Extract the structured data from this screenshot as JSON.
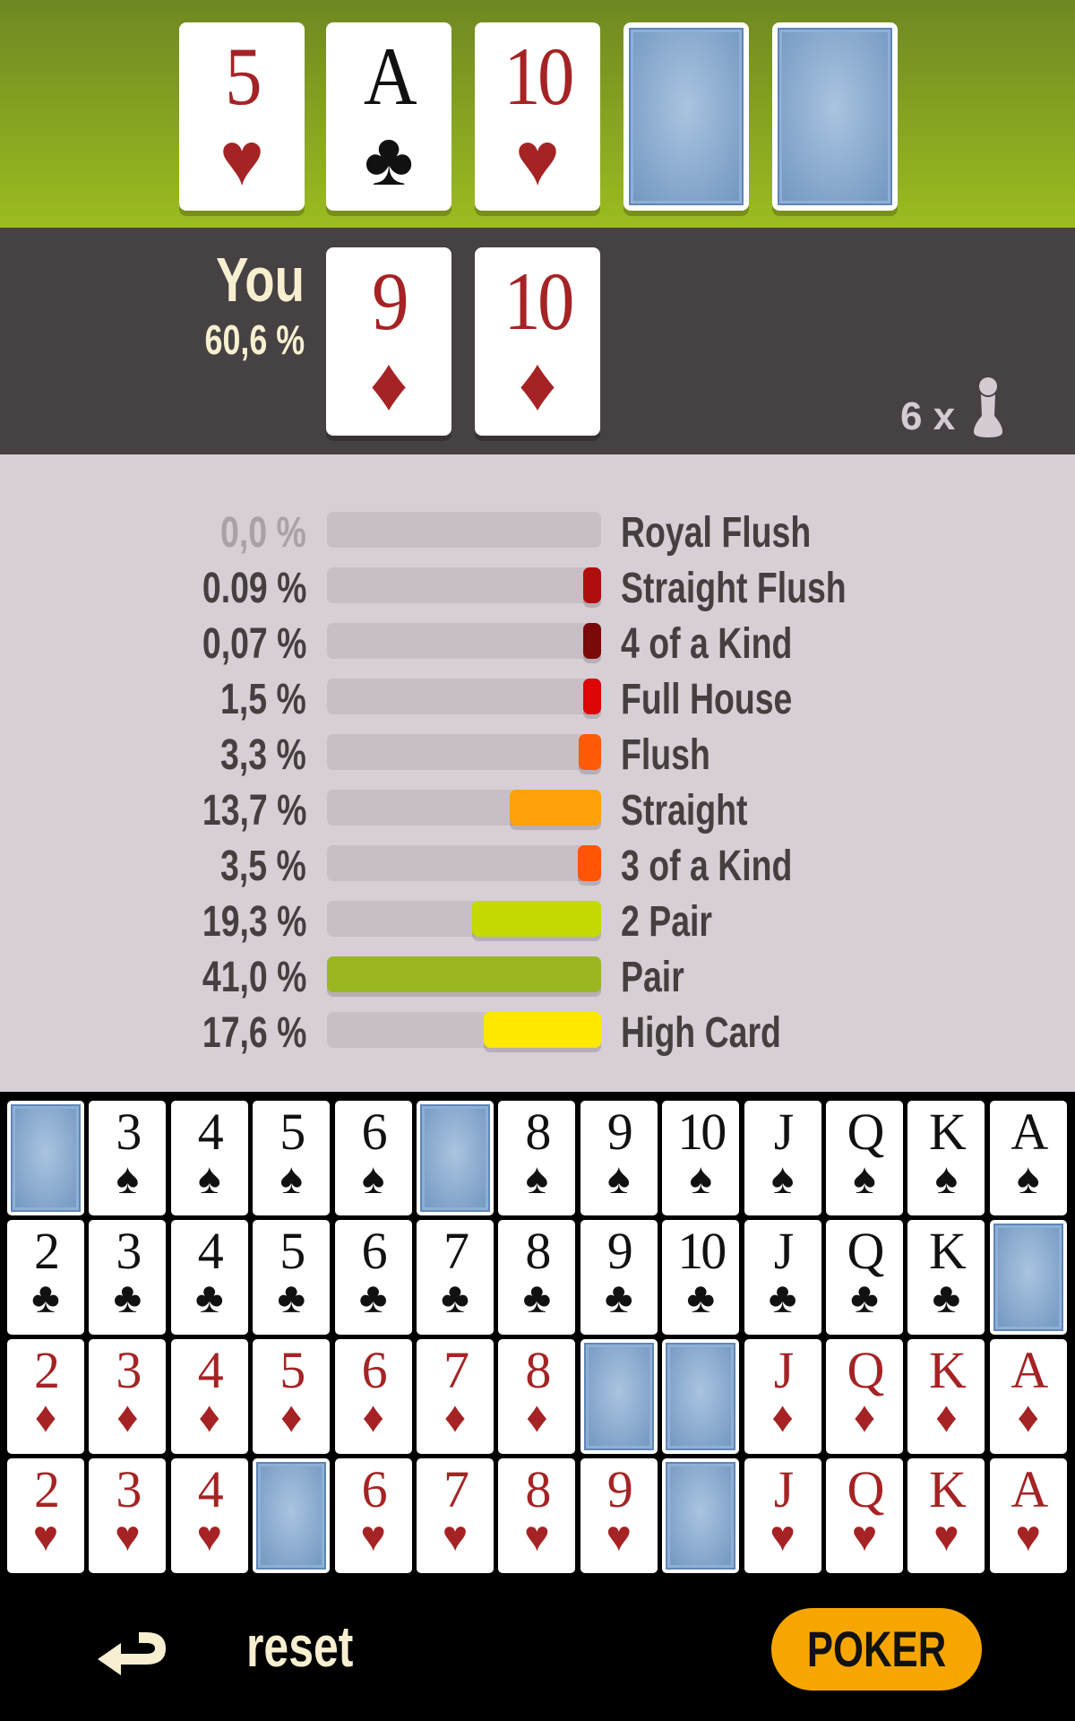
{
  "board": {
    "cards": [
      {
        "rank": "5",
        "suit": "♥",
        "color": "red",
        "face_up": true
      },
      {
        "rank": "A",
        "suit": "♣",
        "color": "black",
        "face_up": true
      },
      {
        "rank": "10",
        "suit": "♥",
        "color": "red",
        "face_up": true
      },
      {
        "face_up": false
      },
      {
        "face_up": false
      }
    ]
  },
  "player": {
    "name": "You",
    "win_percent": "60,6 %",
    "cards": [
      {
        "rank": "9",
        "suit": "♦",
        "color": "red",
        "face_up": true
      },
      {
        "rank": "10",
        "suit": "♦",
        "color": "red",
        "face_up": true
      }
    ],
    "opponents_label": "6 x",
    "opponents_icon": "pawn-icon"
  },
  "hands": [
    {
      "label": "Royal Flush",
      "percent_text": "0,0 %",
      "value": 0.0,
      "color": "#c8bec5"
    },
    {
      "label": "Straight Flush",
      "percent_text": "0.09 %",
      "value": 0.09,
      "color": "#b00d0d"
    },
    {
      "label": "4 of a Kind",
      "percent_text": "0,07 %",
      "value": 0.07,
      "color": "#7a0a0a"
    },
    {
      "label": "Full House",
      "percent_text": "1,5 %",
      "value": 1.5,
      "color": "#dd0505"
    },
    {
      "label": "Flush",
      "percent_text": "3,3 %",
      "value": 3.3,
      "color": "#ff5a07"
    },
    {
      "label": "Straight",
      "percent_text": "13,7 %",
      "value": 13.7,
      "color": "#ffa10a"
    },
    {
      "label": "3 of a Kind",
      "percent_text": "3,5 %",
      "value": 3.5,
      "color": "#ff5505"
    },
    {
      "label": "2 Pair",
      "percent_text": "19,3 %",
      "value": 19.3,
      "color": "#c3d900"
    },
    {
      "label": "Pair",
      "percent_text": "41,0 %",
      "value": 41.0,
      "color": "#9ab722"
    },
    {
      "label": "High Card",
      "percent_text": "17,6 %",
      "value": 17.6,
      "color": "#ffe800"
    }
  ],
  "deck": [
    {
      "suit": "♠",
      "color": "black",
      "ranks": [
        "2",
        "3",
        "4",
        "5",
        "6",
        "7",
        "8",
        "9",
        "10",
        "J",
        "Q",
        "K",
        "A"
      ],
      "hidden": [
        0,
        5
      ]
    },
    {
      "suit": "♣",
      "color": "black",
      "ranks": [
        "2",
        "3",
        "4",
        "5",
        "6",
        "7",
        "8",
        "9",
        "10",
        "J",
        "Q",
        "K",
        "A"
      ],
      "hidden": [
        12
      ]
    },
    {
      "suit": "♦",
      "color": "red",
      "ranks": [
        "2",
        "3",
        "4",
        "5",
        "6",
        "7",
        "8",
        "9",
        "10",
        "J",
        "Q",
        "K",
        "A"
      ],
      "hidden": [
        7,
        8
      ]
    },
    {
      "suit": "♥",
      "color": "red",
      "ranks": [
        "2",
        "3",
        "4",
        "5",
        "6",
        "7",
        "8",
        "9",
        "10",
        "J",
        "Q",
        "K",
        "A"
      ],
      "hidden": [
        3,
        8
      ]
    }
  ],
  "footer": {
    "reset_label": "reset",
    "reset_icon": "return-arrow-icon",
    "poker_label": "POKER"
  }
}
